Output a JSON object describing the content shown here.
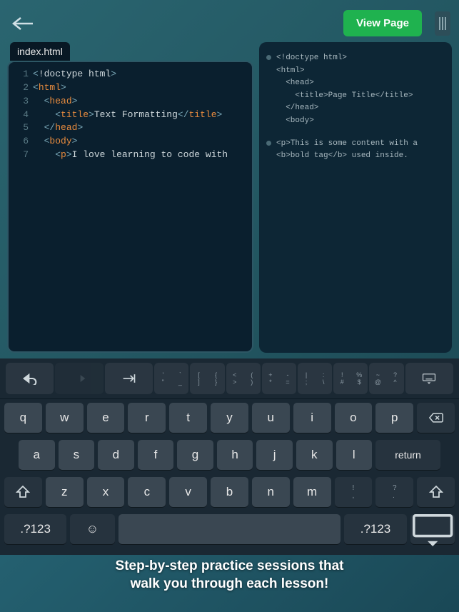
{
  "topbar": {
    "view_page_label": "View Page"
  },
  "editor": {
    "filename": "index.html",
    "lines": [
      {
        "n": "1",
        "segs": [
          {
            "c": "t-bracket",
            "t": "<"
          },
          {
            "c": "t-doctype",
            "t": "!doctype html"
          },
          {
            "c": "t-bracket",
            "t": ">"
          }
        ]
      },
      {
        "n": "2",
        "segs": [
          {
            "c": "t-bracket",
            "t": "<"
          },
          {
            "c": "t-tag",
            "t": "html"
          },
          {
            "c": "t-bracket",
            "t": ">"
          }
        ]
      },
      {
        "n": "3",
        "segs": [
          {
            "c": "",
            "t": "  "
          },
          {
            "c": "t-bracket",
            "t": "<"
          },
          {
            "c": "t-tag",
            "t": "head"
          },
          {
            "c": "t-bracket",
            "t": ">"
          }
        ]
      },
      {
        "n": "4",
        "segs": [
          {
            "c": "",
            "t": "    "
          },
          {
            "c": "t-bracket",
            "t": "<"
          },
          {
            "c": "t-tag",
            "t": "title"
          },
          {
            "c": "t-bracket",
            "t": ">"
          },
          {
            "c": "t-text",
            "t": "Text Formatting"
          },
          {
            "c": "t-bracket",
            "t": "</"
          },
          {
            "c": "t-tag",
            "t": "title"
          },
          {
            "c": "t-bracket",
            "t": ">"
          }
        ]
      },
      {
        "n": "5",
        "segs": [
          {
            "c": "",
            "t": "  "
          },
          {
            "c": "t-bracket",
            "t": "</"
          },
          {
            "c": "t-tag",
            "t": "head"
          },
          {
            "c": "t-bracket",
            "t": ">"
          }
        ]
      },
      {
        "n": "6",
        "segs": [
          {
            "c": "",
            "t": "  "
          },
          {
            "c": "t-bracket",
            "t": "<"
          },
          {
            "c": "t-tag",
            "t": "body"
          },
          {
            "c": "t-bracket",
            "t": ">"
          }
        ]
      },
      {
        "n": "7",
        "segs": [
          {
            "c": "",
            "t": "    "
          },
          {
            "c": "t-bracket",
            "t": "<"
          },
          {
            "c": "t-tag",
            "t": "p"
          },
          {
            "c": "t-bracket",
            "t": ">"
          },
          {
            "c": "t-text",
            "t": "I love learning to code with"
          }
        ]
      }
    ]
  },
  "hints": {
    "block1": "<!doctype html>\n<html>\n  <head>\n    <title>Page Title</title>\n  </head>\n  <body>",
    "block2": "<p>This is some content with a\n<b>bold tag</b> used inside."
  },
  "keyboard": {
    "sym_groups": [
      [
        "[",
        "{",
        "]",
        "}"
      ],
      [
        "<",
        "(",
        ">",
        ")"
      ],
      [
        "+",
        "-",
        "*",
        "="
      ],
      [
        "|",
        ":",
        ";",
        "\\"
      ],
      [
        "!",
        "%",
        "#",
        "$"
      ],
      [
        "~",
        "?",
        "@",
        "^"
      ]
    ],
    "row1": [
      "q",
      "w",
      "e",
      "r",
      "t",
      "y",
      "u",
      "i",
      "o",
      "p"
    ],
    "row2": [
      "a",
      "s",
      "d",
      "f",
      "g",
      "h",
      "j",
      "k",
      "l"
    ],
    "row3": [
      "z",
      "x",
      "c",
      "v",
      "b",
      "n",
      "m"
    ],
    "row3_extra": [
      ",",
      "',",
      "/",
      "."
    ],
    "punct": [
      ",",
      "."
    ],
    "dotnum": ".?123",
    "return": "return"
  },
  "caption_line1": "Step-by-step practice sessions that",
  "caption_line2": "walk you through each lesson!"
}
